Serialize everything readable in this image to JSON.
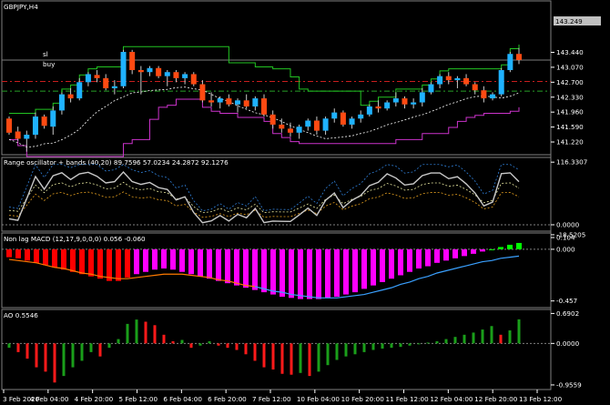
{
  "symbol_label": "GBPJPY,H4",
  "current_price": "143.249",
  "lines": {
    "sl_label": "sl",
    "buy_label": "buy"
  },
  "colors": {
    "bull": "#1fb2ff",
    "bear": "#ff4a12",
    "green_line": "#22c322",
    "magenta": "#cc33cc",
    "red_hist": "#ff0000",
    "magenta_hist": "#ff00ff",
    "green_hist": "#00ff00",
    "ao_red": "#ff1a1a",
    "ao_green": "#1a9e1a",
    "range_main": "#c8c8c8",
    "range_blue": "#2f7fd8",
    "range_orange": "#e6a020",
    "macd_blue": "#3aa0ff",
    "macd_orange": "#ff7a00"
  },
  "chart_data": [
    {
      "type": "candlestick",
      "title": "GBPJPY,H4",
      "ylim": [
        140.95,
        144.6
      ],
      "y_ticks": [
        "143.440",
        "143.070",
        "142.700",
        "142.330",
        "141.960",
        "141.590",
        "141.220"
      ],
      "x_ticks": [
        "3 Feb 2020",
        "4 Feb 04:00",
        "4 Feb 20:00",
        "5 Feb 12:00",
        "6 Feb 04:00",
        "6 Feb 20:00",
        "7 Feb 12:00",
        "10 Feb 04:00",
        "10 Feb 20:00",
        "11 Feb 12:00",
        "12 Feb 04:00",
        "12 Feb 20:00",
        "13 Feb 12:00"
      ],
      "levels": {
        "sl": 142.72,
        "buy": 142.48,
        "current": 143.249
      },
      "ohlc": [
        [
          141.8,
          141.85,
          141.4,
          141.45
        ],
        [
          141.48,
          141.6,
          141.25,
          141.3
        ],
        [
          141.3,
          141.5,
          140.98,
          141.4
        ],
        [
          141.4,
          141.95,
          141.3,
          141.85
        ],
        [
          141.85,
          141.9,
          141.55,
          141.62
        ],
        [
          141.6,
          142.1,
          141.4,
          142.0
        ],
        [
          142.0,
          142.45,
          141.9,
          142.4
        ],
        [
          142.4,
          142.55,
          142.2,
          142.3
        ],
        [
          142.3,
          142.8,
          142.25,
          142.7
        ],
        [
          142.7,
          142.95,
          142.6,
          142.9
        ],
        [
          142.88,
          143.0,
          142.7,
          142.8
        ],
        [
          142.8,
          142.9,
          142.5,
          142.55
        ],
        [
          142.55,
          142.75,
          142.4,
          142.6
        ],
        [
          142.6,
          143.5,
          142.55,
          143.45
        ],
        [
          143.45,
          143.5,
          142.9,
          143.0
        ],
        [
          143.0,
          143.1,
          142.4,
          142.95
        ],
        [
          142.95,
          143.1,
          142.85,
          143.05
        ],
        [
          143.05,
          143.1,
          142.8,
          142.85
        ],
        [
          142.85,
          143.0,
          142.6,
          142.95
        ],
        [
          142.95,
          143.0,
          142.7,
          142.8
        ],
        [
          142.8,
          142.95,
          142.65,
          142.9
        ],
        [
          142.9,
          142.95,
          142.6,
          142.65
        ],
        [
          142.65,
          142.75,
          142.2,
          142.25
        ],
        [
          142.25,
          142.45,
          142.1,
          142.2
        ],
        [
          142.2,
          142.35,
          142.05,
          142.3
        ],
        [
          142.3,
          142.4,
          142.1,
          142.15
        ],
        [
          142.15,
          142.3,
          141.95,
          142.25
        ],
        [
          142.25,
          142.4,
          142.05,
          142.1
        ],
        [
          142.1,
          142.35,
          142.0,
          142.3
        ],
        [
          142.3,
          142.4,
          141.85,
          141.9
        ],
        [
          141.9,
          142.0,
          141.55,
          141.65
        ],
        [
          141.65,
          141.8,
          141.45,
          141.55
        ],
        [
          141.55,
          141.7,
          141.35,
          141.45
        ],
        [
          141.45,
          141.65,
          141.3,
          141.6
        ],
        [
          141.6,
          141.8,
          141.5,
          141.75
        ],
        [
          141.75,
          141.85,
          141.4,
          141.5
        ],
        [
          141.5,
          141.85,
          141.4,
          141.8
        ],
        [
          141.8,
          142.05,
          141.7,
          141.95
        ],
        [
          141.95,
          142.0,
          141.6,
          141.65
        ],
        [
          141.65,
          141.85,
          141.55,
          141.8
        ],
        [
          141.8,
          142.0,
          141.7,
          141.9
        ],
        [
          141.9,
          142.15,
          141.85,
          142.1
        ],
        [
          142.1,
          142.25,
          141.95,
          142.05
        ],
        [
          142.05,
          142.25,
          142.0,
          142.2
        ],
        [
          142.2,
          142.45,
          142.1,
          142.3
        ],
        [
          142.3,
          142.35,
          142.05,
          142.15
        ],
        [
          142.15,
          142.3,
          142.05,
          142.2
        ],
        [
          142.2,
          142.55,
          142.1,
          142.45
        ],
        [
          142.45,
          142.7,
          142.4,
          142.65
        ],
        [
          142.65,
          142.9,
          142.55,
          142.85
        ],
        [
          142.85,
          142.95,
          142.65,
          142.75
        ],
        [
          142.75,
          142.85,
          142.55,
          142.8
        ],
        [
          142.8,
          142.9,
          142.6,
          142.65
        ],
        [
          142.65,
          142.7,
          142.4,
          142.5
        ],
        [
          142.5,
          142.6,
          142.2,
          142.3
        ],
        [
          142.3,
          142.45,
          142.25,
          142.4
        ],
        [
          142.4,
          143.05,
          142.35,
          143.0
        ],
        [
          143.0,
          143.45,
          142.95,
          143.4
        ],
        [
          143.4,
          143.55,
          143.15,
          143.25
        ]
      ]
    },
    {
      "type": "line",
      "title": "Range oscillator + bands (40,20) 89.7596 57.0234 24.2872 92.1276",
      "ylim": [
        -8.5,
        120
      ],
      "y_ticks": [
        "116.3307",
        "0.0000",
        "-18.5205"
      ]
    },
    {
      "type": "bar",
      "title": "Non lag MACD (12,17,9,0,0,0) 0.056 -0.060",
      "ylim": [
        -0.5,
        0.12
      ],
      "y_ticks": [
        "0.104",
        "0.000",
        "-0.457"
      ],
      "values": [
        -0.07,
        -0.08,
        -0.1,
        -0.12,
        -0.14,
        -0.16,
        -0.18,
        -0.2,
        -0.22,
        -0.24,
        -0.26,
        -0.28,
        -0.28,
        -0.25,
        -0.22,
        -0.2,
        -0.18,
        -0.17,
        -0.18,
        -0.2,
        -0.22,
        -0.24,
        -0.26,
        -0.28,
        -0.3,
        -0.32,
        -0.34,
        -0.36,
        -0.38,
        -0.4,
        -0.42,
        -0.43,
        -0.44,
        -0.44,
        -0.44,
        -0.43,
        -0.42,
        -0.4,
        -0.38,
        -0.35,
        -0.32,
        -0.29,
        -0.26,
        -0.23,
        -0.2,
        -0.17,
        -0.15,
        -0.12,
        -0.1,
        -0.08,
        -0.06,
        -0.04,
        -0.02,
        0.0,
        0.02,
        0.04,
        0.056
      ],
      "signal": [
        -0.09,
        -0.1,
        -0.11,
        -0.12,
        -0.14,
        -0.16,
        -0.17,
        -0.19,
        -0.21,
        -0.22,
        -0.24,
        -0.25,
        -0.26,
        -0.26,
        -0.25,
        -0.24,
        -0.23,
        -0.22,
        -0.22,
        -0.22,
        -0.23,
        -0.24,
        -0.25,
        -0.27,
        -0.28,
        -0.3,
        -0.32,
        -0.33,
        -0.35,
        -0.37,
        -0.38,
        -0.4,
        -0.41,
        -0.42,
        -0.43,
        -0.43,
        -0.43,
        -0.42,
        -0.41,
        -0.4,
        -0.38,
        -0.36,
        -0.34,
        -0.31,
        -0.29,
        -0.26,
        -0.24,
        -0.21,
        -0.19,
        -0.17,
        -0.15,
        -0.13,
        -0.11,
        -0.1,
        -0.08,
        -0.07,
        -0.06
      ]
    },
    {
      "type": "bar",
      "title": "AO 0.5546",
      "ylim": [
        -1.02,
        0.72
      ],
      "y_ticks": [
        "0.6902",
        "0.0000",
        "-0.9559"
      ],
      "values": [
        -0.1,
        -0.2,
        -0.35,
        -0.55,
        -0.65,
        -0.9,
        -0.75,
        -0.55,
        -0.4,
        -0.2,
        -0.3,
        -0.1,
        0.1,
        0.45,
        0.55,
        0.5,
        0.42,
        0.2,
        0.05,
        0.08,
        -0.1,
        -0.05,
        0.05,
        -0.05,
        -0.1,
        -0.15,
        -0.25,
        -0.4,
        -0.55,
        -0.6,
        -0.7,
        -0.72,
        -0.68,
        -0.75,
        -0.65,
        -0.5,
        -0.38,
        -0.3,
        -0.25,
        -0.2,
        -0.15,
        -0.12,
        -0.1,
        -0.08,
        -0.05,
        0.0,
        0.02,
        0.05,
        0.1,
        0.15,
        0.2,
        0.25,
        0.32,
        0.4,
        0.2,
        0.3,
        0.5546
      ]
    }
  ]
}
